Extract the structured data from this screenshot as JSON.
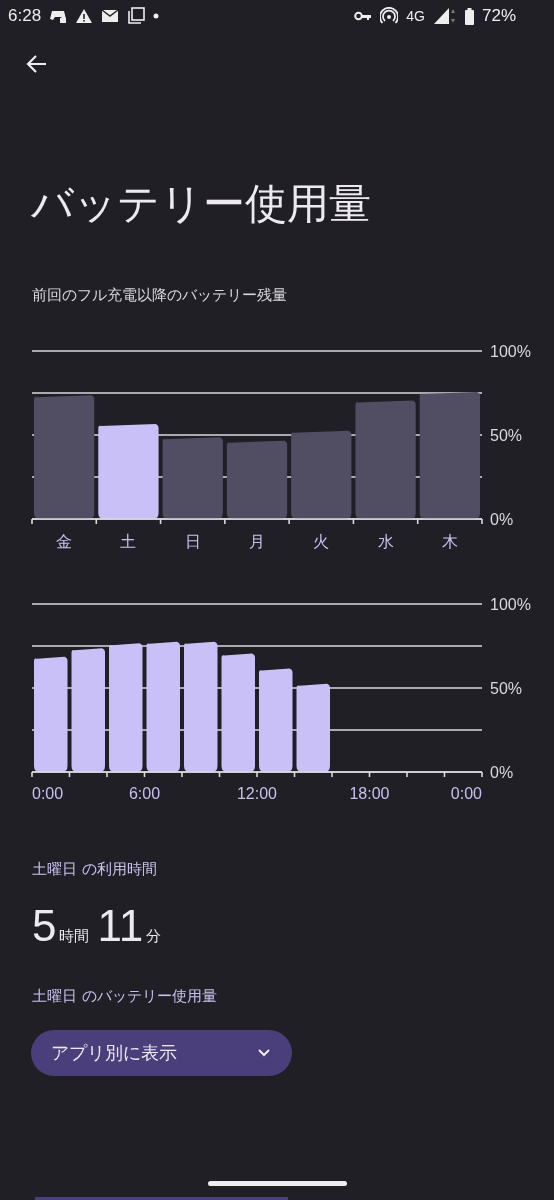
{
  "status_bar": {
    "time": "6:28",
    "network": "4G",
    "battery": "72%"
  },
  "title": "バッテリー使用量",
  "subtitle": "前回のフル充電以降のバッテリー残量",
  "weekly_chart": {
    "chart_data": {
      "type": "bar",
      "categories": [
        "金",
        "土",
        "日",
        "月",
        "火",
        "水",
        "木"
      ],
      "series": [
        {
          "colors": [
            "#514e63",
            "#c9c0f8",
            "#514e63",
            "#514e63",
            "#514e63",
            "#514e63",
            "#514e63"
          ],
          "values": [
            73,
            56,
            48,
            46,
            52,
            70,
            75
          ]
        }
      ],
      "ylim": [
        0,
        100
      ],
      "yticks": [
        {
          "value": 0,
          "label": "0%"
        },
        {
          "value": 50,
          "label": "50%"
        },
        {
          "value": 100,
          "label": "100%"
        }
      ]
    }
  },
  "daily_chart": {
    "chart_data": {
      "type": "bar",
      "x": [
        1,
        3,
        5,
        7,
        9,
        11,
        13,
        15
      ],
      "series": [
        {
          "color": "#c9c0f8",
          "values": [
            68,
            73,
            76,
            77,
            77,
            70,
            61,
            52
          ]
        }
      ],
      "xlim": [
        0,
        24
      ],
      "ylim": [
        0,
        100
      ],
      "xticks": [
        {
          "value": 0,
          "label": "0:00"
        },
        {
          "value": 6,
          "label": "6:00"
        },
        {
          "value": 12,
          "label": "12:00"
        },
        {
          "value": 18,
          "label": "18:00"
        },
        {
          "value": 24,
          "label": "0:00"
        }
      ],
      "yticks": [
        {
          "value": 0,
          "label": "0%"
        },
        {
          "value": 50,
          "label": "50%"
        },
        {
          "value": 100,
          "label": "100%"
        }
      ]
    }
  },
  "usage_label": "土曜日 の利用時間",
  "usage_time": [
    {
      "value": "5",
      "unit": "時間"
    },
    {
      "value": "11",
      "unit": "分"
    }
  ],
  "battery_label": "土曜日 のバッテリー使用量",
  "view_dropdown": {
    "label": "アプリ別に表示"
  }
}
